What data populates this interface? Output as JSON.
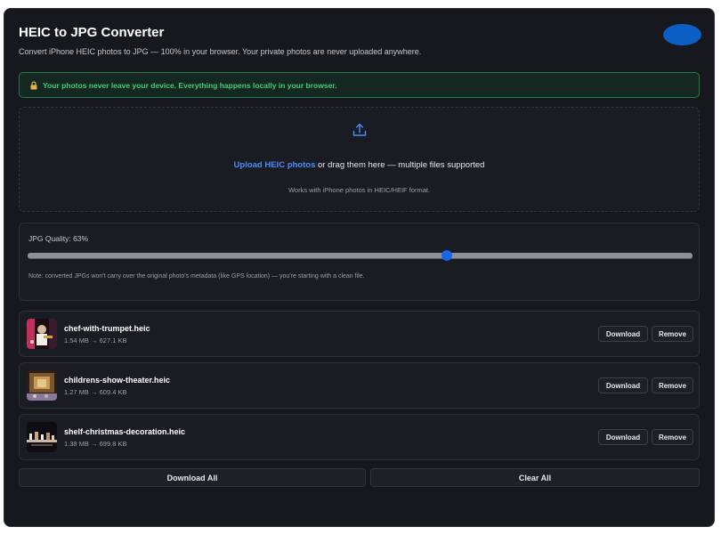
{
  "header": {
    "title": "HEIC to JPG Converter",
    "subtitle": "Convert iPhone HEIC photos to JPG — 100% in your browser. Your private photos are never uploaded anywhere."
  },
  "notice": {
    "text": "Your photos never leave your device. Everything happens locally in your browser.",
    "icon": "lock-icon",
    "color": "#3ecf73"
  },
  "dropzone": {
    "upload_link": "Upload HEIC photos",
    "drag_text": " or drag them here — multiple files supported",
    "hint": "Works with iPhone photos in HEIC/HEIF format.",
    "icon": "upload-icon"
  },
  "quality": {
    "label": "JPG Quality: 63%",
    "value_percent": 63,
    "note": "Note: converted JPGs won't carry over the original photo's metadata (like GPS location) — you're starting with a clean file."
  },
  "files": [
    {
      "name": "chef-with-trumpet.heic",
      "size": "1.54 MB → 627.1 KB",
      "download_label": "Download",
      "remove_label": "Remove"
    },
    {
      "name": "childrens-show-theater.heic",
      "size": "1.27 MB → 609.4 KB",
      "download_label": "Download",
      "remove_label": "Remove"
    },
    {
      "name": "shelf-christmas-decoration.heic",
      "size": "1.38 MB → 699.8 KB",
      "download_label": "Download",
      "remove_label": "Remove"
    }
  ],
  "actions": {
    "download_all": "Download All",
    "clear_all": "Clear All"
  },
  "colors": {
    "accent": "#1667e6",
    "link": "#4a8cf7",
    "background": "#16181d"
  }
}
